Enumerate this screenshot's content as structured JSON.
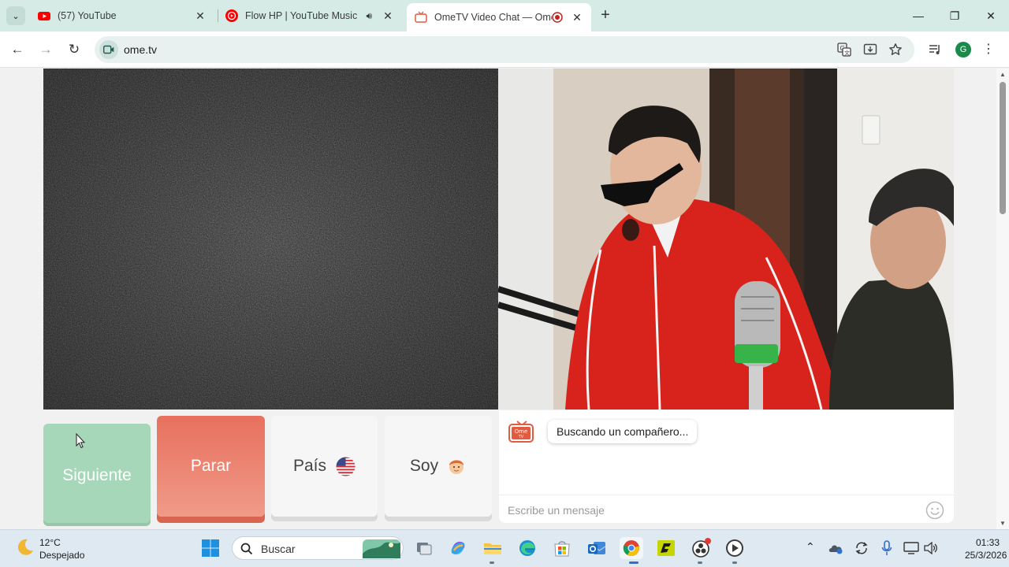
{
  "browser": {
    "tabs": [
      {
        "title": "(57) YouTube",
        "favicon": "youtube-icon"
      },
      {
        "title": "Flow HP | YouTube Music",
        "favicon": "youtube-music-icon",
        "audio": true
      },
      {
        "title": "OmeTV Video Chat — Ome",
        "favicon": "ometv-icon",
        "recording": true,
        "active": true
      }
    ],
    "url": "ome.tv",
    "profile_initial": "G"
  },
  "page": {
    "buttons": {
      "next": "Siguiente",
      "stop": "Parar",
      "country": "País",
      "gender": "Soy"
    },
    "chat": {
      "status": "Buscando un compañero...",
      "placeholder": "Escribe un mensaje"
    }
  },
  "taskbar": {
    "weather_temp": "12°C",
    "weather_cond": "Despejado",
    "search": "Buscar",
    "time": "01:33",
    "date": "25/3/2026"
  },
  "colors": {
    "next_button": "#a6d7b8",
    "stop_button": "#e8705e",
    "tabbar": "#d6ebe6"
  }
}
